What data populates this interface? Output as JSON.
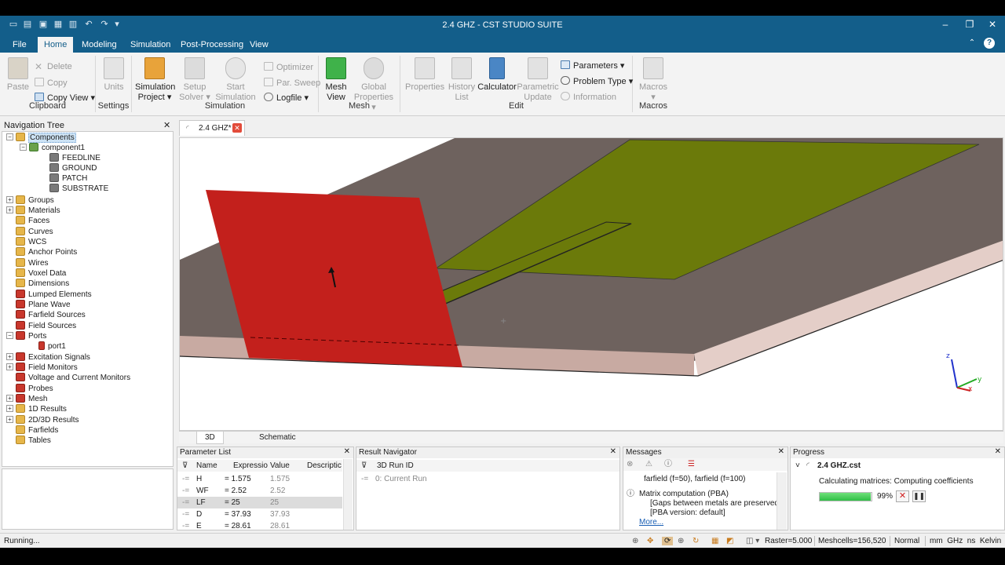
{
  "window": {
    "title": "2.4 GHZ - CST STUDIO SUITE"
  },
  "menu": {
    "tabs": [
      "File",
      "Home",
      "Modeling",
      "Simulation",
      "Post-Processing",
      "View"
    ]
  },
  "ribbon": {
    "clipboard": {
      "paste": "Paste",
      "delete": "Delete",
      "copy": "Copy",
      "copy_view": "Copy View",
      "label": "Clipboard"
    },
    "settings": {
      "units": "Units",
      "label": "Settings"
    },
    "simulation": {
      "sim_project_1": "Simulation",
      "sim_project_2": "Project",
      "setup_solver_1": "Setup",
      "setup_solver_2": "Solver",
      "start_sim_1": "Start",
      "start_sim_2": "Simulation",
      "optimizer": "Optimizer",
      "par_sweep": "Par. Sweep",
      "logfile": "Logfile",
      "label": "Simulation"
    },
    "mesh": {
      "mesh_view_1": "Mesh",
      "mesh_view_2": "View",
      "global_props_1": "Global",
      "global_props_2": "Properties",
      "label": "Mesh"
    },
    "edit": {
      "properties": "Properties",
      "history_1": "History",
      "history_2": "List",
      "calculator": "Calculator",
      "param_update_1": "Parametric",
      "param_update_2": "Update",
      "parameters": "Parameters",
      "problem_type": "Problem Type",
      "information": "Information",
      "label": "Edit"
    },
    "macros": {
      "macros": "Macros",
      "label": "Macros"
    }
  },
  "nav": {
    "title": "Navigation Tree",
    "items": {
      "components": "Components",
      "component1": "component1",
      "feedline": "FEEDLINE",
      "ground": "GROUND",
      "patch": "PATCH",
      "substrate": "SUBSTRATE",
      "groups": "Groups",
      "materials": "Materials",
      "faces": "Faces",
      "curves": "Curves",
      "wcs": "WCS",
      "anchor_points": "Anchor Points",
      "wires": "Wires",
      "voxel_data": "Voxel Data",
      "dimensions": "Dimensions",
      "lumped_elements": "Lumped Elements",
      "plane_wave": "Plane Wave",
      "farfield_sources": "Farfield Sources",
      "field_sources": "Field Sources",
      "ports": "Ports",
      "port1": "port1",
      "excitation_signals": "Excitation Signals",
      "field_monitors": "Field Monitors",
      "vc_monitors": "Voltage and Current Monitors",
      "probes": "Probes",
      "mesh": "Mesh",
      "results_1d": "1D Results",
      "results_2d3d": "2D/3D Results",
      "farfields": "Farfields",
      "tables": "Tables"
    }
  },
  "document": {
    "tab": "2.4 GHZ*",
    "view_tabs": [
      "3D",
      "Schematic"
    ]
  },
  "parameter_list": {
    "title": "Parameter List",
    "columns": [
      "Name",
      "Expressio",
      "Value",
      "Descriptic"
    ],
    "rows": [
      {
        "name": "H",
        "expr": "= 1.575",
        "value": "1.575"
      },
      {
        "name": "WF",
        "expr": "= 2.52",
        "value": "2.52"
      },
      {
        "name": "LF",
        "expr": "= 25",
        "value": "25"
      },
      {
        "name": "D",
        "expr": "= 37.93",
        "value": "37.93"
      },
      {
        "name": "E",
        "expr": "= 28.61",
        "value": "28.61"
      }
    ]
  },
  "result_navigator": {
    "title": "Result Navigator",
    "column": "3D Run ID",
    "row": "0: Current Run"
  },
  "messages": {
    "title": "Messages",
    "line1": "farfield (f=50), farfield (f=100)",
    "line2": "Matrix computation (PBA)",
    "line3": "[Gaps between metals are preserved]",
    "line4": "[PBA version: default]",
    "more": "More..."
  },
  "progress": {
    "title": "Progress",
    "file": "2.4 GHZ.cst",
    "status": "Calculating matrices: Computing coefficients",
    "percent_text": "99%",
    "percent": 99
  },
  "status": {
    "left": "Running...",
    "raster": "Raster=5.000",
    "meshcells": "Meshcells=156,520",
    "mode": "Normal",
    "units": "mm  GHz  ns  Kelvin"
  },
  "colors": {
    "title_blue": "#135e8a",
    "patch_green": "#6b7a0a",
    "port_red": "#c3201c",
    "substrate_brown": "#6e625e",
    "progress_green": "#34c24a"
  }
}
